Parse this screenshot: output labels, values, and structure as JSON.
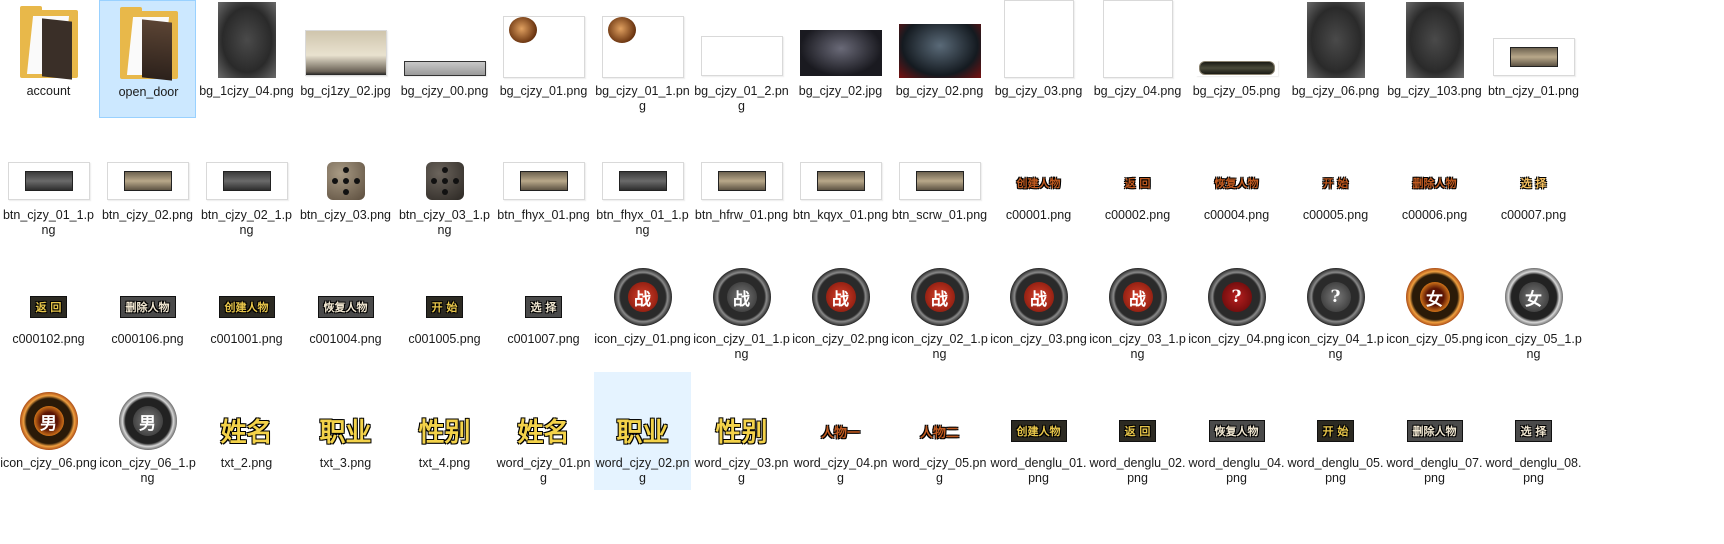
{
  "explorer": {
    "items": [
      {
        "name": "account",
        "kind": "folder-plain"
      },
      {
        "name": "open_door",
        "kind": "folder-door",
        "selected": true
      },
      {
        "name": "bg_1cjzy_04.png",
        "kind": "dark-art-tall"
      },
      {
        "name": "bg_cj1zy_02.jpg",
        "kind": "parchment"
      },
      {
        "name": "bg_cjzy_00.png",
        "kind": "silver-bar"
      },
      {
        "name": "bg_cjzy_01.png",
        "kind": "white-face"
      },
      {
        "name": "bg_cjzy_01_1.png",
        "kind": "white-face"
      },
      {
        "name": "bg_cjzy_01_2.png",
        "kind": "white-blank"
      },
      {
        "name": "bg_cjzy_02.jpg",
        "kind": "dungeon-hall"
      },
      {
        "name": "bg_cjzy_02.png",
        "kind": "dungeon-hall-red"
      },
      {
        "name": "bg_cjzy_03.png",
        "kind": "white-tall"
      },
      {
        "name": "bg_cjzy_04.png",
        "kind": "white-tall"
      },
      {
        "name": "bg_cjzy_05.png",
        "kind": "dark-pill"
      },
      {
        "name": "bg_cjzy_06.png",
        "kind": "dark-art-tall"
      },
      {
        "name": "bg_cjzy_103.png",
        "kind": "dark-art-tall"
      },
      {
        "name": "btn_cjzy_01.png",
        "kind": "bar-tan-frame"
      },
      {
        "name": "btn_cjzy_01_1.png",
        "kind": "bar-grey-frame"
      },
      {
        "name": "btn_cjzy_02.png",
        "kind": "bar-tan-frame"
      },
      {
        "name": "btn_cjzy_02_1.png",
        "kind": "bar-grey-frame"
      },
      {
        "name": "btn_cjzy_03.png",
        "kind": "die-light"
      },
      {
        "name": "btn_cjzy_03_1.png",
        "kind": "die-dark"
      },
      {
        "name": "btn_fhyx_01.png",
        "kind": "bar-tan-frame"
      },
      {
        "name": "btn_fhyx_01_1.png",
        "kind": "bar-grey-frame"
      },
      {
        "name": "btn_hfrw_01.png",
        "kind": "bar-tan-frame"
      },
      {
        "name": "btn_kqyx_01.png",
        "kind": "bar-tan-frame"
      },
      {
        "name": "btn_scrw_01.png",
        "kind": "bar-tan-frame"
      },
      {
        "name": "c00001.png",
        "kind": "text-brown",
        "glyph": "创建人物"
      },
      {
        "name": "c00002.png",
        "kind": "text-brown",
        "glyph": "返 回"
      },
      {
        "name": "c00004.png",
        "kind": "text-brown",
        "glyph": "恢复人物"
      },
      {
        "name": "c00005.png",
        "kind": "text-brown",
        "glyph": "开 始"
      },
      {
        "name": "c00006.png",
        "kind": "text-brown",
        "glyph": "删除人物"
      },
      {
        "name": "c00007.png",
        "kind": "text-pale",
        "glyph": "选 择"
      },
      {
        "name": "c000102.png",
        "kind": "text-plate",
        "glyph": "返  回"
      },
      {
        "name": "c000106.png",
        "kind": "text-plate-grey",
        "glyph": "删除人物"
      },
      {
        "name": "c001001.png",
        "kind": "text-plate",
        "glyph": "创建人物"
      },
      {
        "name": "c001004.png",
        "kind": "text-plate-grey",
        "glyph": "恢复人物"
      },
      {
        "name": "c001005.png",
        "kind": "text-plate",
        "glyph": "开  始"
      },
      {
        "name": "c001007.png",
        "kind": "text-plate-grey",
        "glyph": "选  择"
      },
      {
        "name": "icon_cjzy_01.png",
        "kind": "medal",
        "core": "red",
        "glyph": "战"
      },
      {
        "name": "icon_cjzy_01_1.png",
        "kind": "medal",
        "core": "grey",
        "glyph": "战"
      },
      {
        "name": "icon_cjzy_02.png",
        "kind": "medal",
        "core": "red",
        "glyph": "战"
      },
      {
        "name": "icon_cjzy_02_1.png",
        "kind": "medal",
        "core": "red",
        "glyph": "战"
      },
      {
        "name": "icon_cjzy_03.png",
        "kind": "medal",
        "core": "red",
        "glyph": "战"
      },
      {
        "name": "icon_cjzy_03_1.png",
        "kind": "medal",
        "core": "red",
        "glyph": "战"
      },
      {
        "name": "icon_cjzy_04.png",
        "kind": "medal",
        "core": "darkred",
        "glyph": "?"
      },
      {
        "name": "icon_cjzy_04_1.png",
        "kind": "medal",
        "core": "grey",
        "glyph": "?"
      },
      {
        "name": "icon_cjzy_05.png",
        "kind": "medal-gold",
        "core": "gold",
        "glyph": "女"
      },
      {
        "name": "icon_cjzy_05_1.png",
        "kind": "medal-silver",
        "core": "grey",
        "glyph": "女"
      },
      {
        "name": "icon_cjzy_06.png",
        "kind": "medal-gold",
        "core": "gold",
        "glyph": "男"
      },
      {
        "name": "icon_cjzy_06_1.png",
        "kind": "medal-silver",
        "core": "grey",
        "glyph": "男"
      },
      {
        "name": "txt_2.png",
        "kind": "text-big",
        "glyph": "姓名"
      },
      {
        "name": "txt_3.png",
        "kind": "text-big",
        "glyph": "职业"
      },
      {
        "name": "txt_4.png",
        "kind": "text-big",
        "glyph": "性别"
      },
      {
        "name": "word_cjzy_01.png",
        "kind": "text-big",
        "glyph": "姓名"
      },
      {
        "name": "word_cjzy_02.png",
        "kind": "text-big",
        "glyph": "职业",
        "hover": true
      },
      {
        "name": "word_cjzy_03.png",
        "kind": "text-big",
        "glyph": "性别"
      },
      {
        "name": "word_cjzy_04.png",
        "kind": "text-brown-med",
        "glyph": "人物一"
      },
      {
        "name": "word_cjzy_05.png",
        "kind": "text-brown-med",
        "glyph": "人物二"
      },
      {
        "name": "word_denglu_01.png",
        "kind": "text-plate",
        "glyph": "创建人物"
      },
      {
        "name": "word_denglu_02.png",
        "kind": "text-plate",
        "glyph": "返  回"
      },
      {
        "name": "word_denglu_04.png",
        "kind": "text-plate-grey",
        "glyph": "恢复人物"
      },
      {
        "name": "word_denglu_05.png",
        "kind": "text-plate",
        "glyph": "开  始"
      },
      {
        "name": "word_denglu_07.png",
        "kind": "text-plate-grey",
        "glyph": "删除人物"
      },
      {
        "name": "word_denglu_08.png",
        "kind": "text-plate-grey",
        "glyph": "选  择"
      }
    ]
  }
}
